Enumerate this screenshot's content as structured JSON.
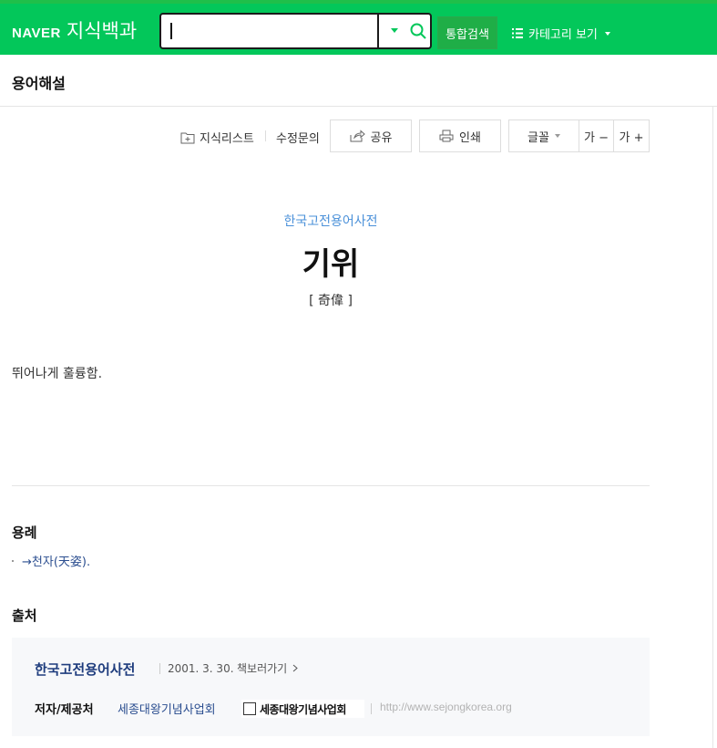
{
  "header": {
    "brand": "NAVER",
    "service": "지식백과",
    "search": {
      "value": "",
      "placeholder": ""
    },
    "total_search_label": "통합검색",
    "category_label": "카테고리 보기"
  },
  "section_title": "용어해설",
  "toolbar": {
    "knowledge_list": "지식리스트",
    "edit_request": "수정문의",
    "share": "공유",
    "print": "인쇄",
    "font": "글꼴",
    "font_smaller": "가 −",
    "font_larger": "가 +"
  },
  "entry": {
    "dictionary": "한국고전용어사전",
    "title": "기위",
    "hanja": "[ 奇偉 ]",
    "definition": "뛰어나게 훌륭함."
  },
  "examples": {
    "label": "용례",
    "items": [
      "→천자(天姿)."
    ]
  },
  "source": {
    "label": "출처",
    "book_title": "한국고전용어사전",
    "date": "2001. 3. 30.",
    "view_book": "책보러가기",
    "author_label": "저자/제공처",
    "author": "세종대왕기념사업회",
    "logo_text": "세종대왕기념사업회",
    "url": "http://www.sejongkorea.org"
  },
  "colors": {
    "brand_green": "#03c75a",
    "link_blue": "#2a4d8f",
    "dict_blue": "#4a90d9"
  }
}
